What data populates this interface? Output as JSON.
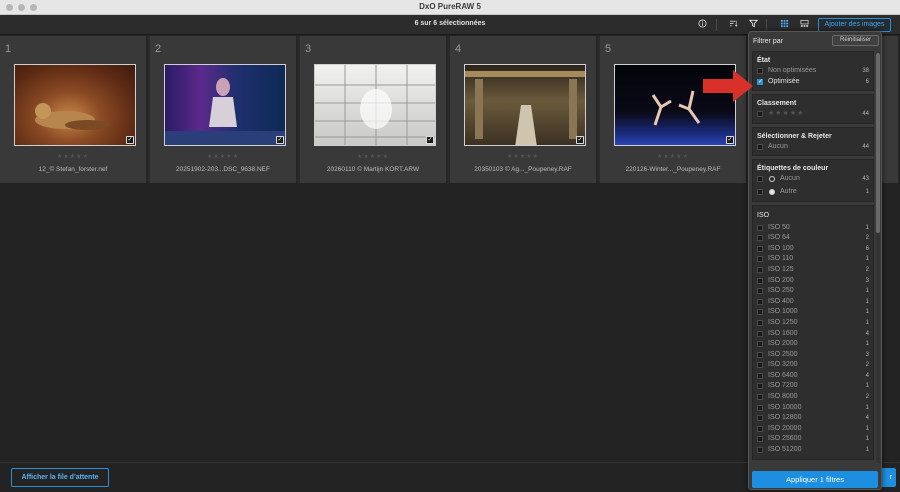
{
  "window": {
    "title": "DxO PureRAW 5"
  },
  "toolbar": {
    "selection_count": "6 sur 6 sélectionnées",
    "add_images_label": "Ajouter des images",
    "icons": [
      "info-icon",
      "sort-icon",
      "filter-icon",
      "grid-view-icon",
      "compare-view-icon"
    ]
  },
  "thumbnails": [
    {
      "number": "1",
      "filename": "12_© Stefan_forster.nef",
      "selected": true
    },
    {
      "number": "2",
      "filename": "20251902-203...DSC_9638.NEF",
      "selected": true
    },
    {
      "number": "3",
      "filename": "20260110 © Martijn KORT.ARW",
      "selected": true
    },
    {
      "number": "4",
      "filename": "20350103 © Ag..._Poupeney.RAF",
      "selected": true
    },
    {
      "number": "5",
      "filename": "220126-Winter..._Poupeney.RAF",
      "selected": true
    }
  ],
  "filter_panel": {
    "title": "Filtrer par",
    "reset_label": "Réinitialiser",
    "etat": {
      "title": "État",
      "items": [
        {
          "label": "Non optimisées",
          "count": "38",
          "checked": false
        },
        {
          "label": "Optimisée",
          "count": "6",
          "checked": true
        }
      ]
    },
    "classement": {
      "title": "Classement",
      "stars": "★★★★★",
      "count": "44"
    },
    "select_reject": {
      "title": "Sélectionner & Rejeter",
      "items": [
        {
          "label": "Aucun",
          "count": "44"
        }
      ]
    },
    "color_labels": {
      "title": "Étiquettes de couleur",
      "items": [
        {
          "label": "Aucun",
          "count": "43",
          "filled": false
        },
        {
          "label": "Autre",
          "count": "1",
          "filled": true
        }
      ]
    },
    "iso": {
      "title": "ISO",
      "items": [
        {
          "label": "ISO 50",
          "count": "1"
        },
        {
          "label": "ISO 64",
          "count": "2"
        },
        {
          "label": "ISO 100",
          "count": "6"
        },
        {
          "label": "ISO 110",
          "count": "1"
        },
        {
          "label": "ISO 125",
          "count": "2"
        },
        {
          "label": "ISO 200",
          "count": "3"
        },
        {
          "label": "ISO 250",
          "count": "1"
        },
        {
          "label": "ISO 400",
          "count": "1"
        },
        {
          "label": "ISO 1000",
          "count": "1"
        },
        {
          "label": "ISO 1250",
          "count": "1"
        },
        {
          "label": "ISO 1600",
          "count": "4"
        },
        {
          "label": "ISO 2000",
          "count": "1"
        },
        {
          "label": "ISO 2500",
          "count": "3"
        },
        {
          "label": "ISO 3200",
          "count": "2"
        },
        {
          "label": "ISO 6400",
          "count": "4"
        },
        {
          "label": "ISO 7200",
          "count": "1"
        },
        {
          "label": "ISO 8000",
          "count": "2"
        },
        {
          "label": "ISO 10000",
          "count": "1"
        },
        {
          "label": "ISO 12800",
          "count": "4"
        },
        {
          "label": "ISO 20000",
          "count": "1"
        },
        {
          "label": "ISO 25600",
          "count": "1"
        },
        {
          "label": "ISO 51200",
          "count": "1"
        }
      ]
    },
    "apply_label": "Appliquer 1 filtres"
  },
  "bottom": {
    "queue_label": "Afficher la file d'attente",
    "hidden_button_fragment": "r"
  },
  "colors": {
    "accent": "#1d8fe0",
    "annotation_arrow": "#d9302a"
  }
}
